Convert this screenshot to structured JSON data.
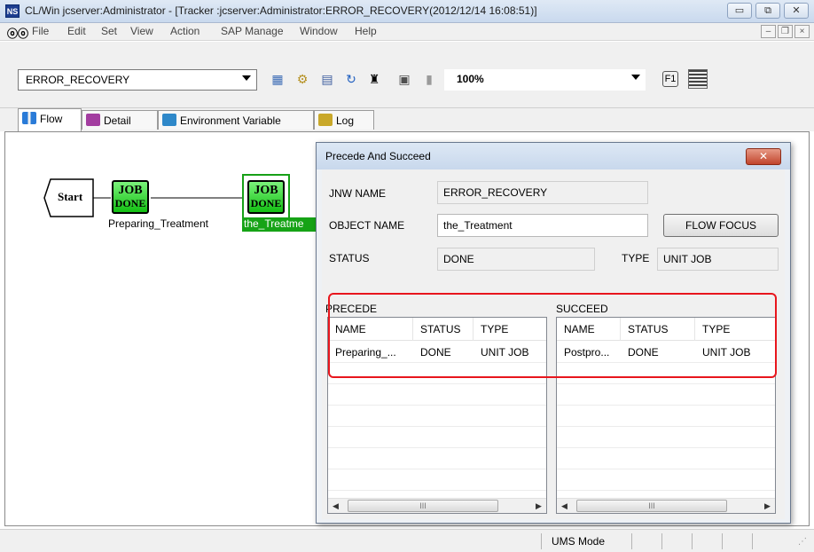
{
  "window": {
    "title": "CL/Win jcserver:Administrator - [Tracker :jcserver:Administrator:ERROR_RECOVERY(2012/12/14 16:08:51)]",
    "app_icon": "NS",
    "minimize": "▭",
    "restore": "⧉",
    "close": "✕"
  },
  "menu": {
    "items": [
      "File",
      "Edit",
      "Set",
      "View",
      "Action",
      "SAP Manage",
      "Window",
      "Help"
    ],
    "mdi_minimize": "–",
    "mdi_restore": "❐",
    "mdi_close": "×"
  },
  "toolbar": {
    "jobnet_select": "ERROR_RECOVERY",
    "zoom_select": "100%"
  },
  "tabs": [
    {
      "label": "Flow",
      "active": true
    },
    {
      "label": "Detail",
      "active": false
    },
    {
      "label": "Environment Variable",
      "active": false
    },
    {
      "label": "Log",
      "active": false
    }
  ],
  "flow": {
    "start_label": "Start",
    "job_line1": "JOB",
    "job_line2": "DONE",
    "job1_name": "Preparing_Treatment",
    "job2_name": "the_Treatme"
  },
  "dialog": {
    "title": "Precede And Succeed",
    "close_label": "✕",
    "jnw_name_label": "JNW NAME",
    "jnw_name_value": "ERROR_RECOVERY",
    "object_name_label": "OBJECT NAME",
    "object_name_value": "the_Treatment",
    "flow_focus_button": "FLOW FOCUS",
    "status_label": "STATUS",
    "status_value": "DONE",
    "type_label": "TYPE",
    "type_value": "UNIT JOB",
    "precede": {
      "caption": "PRECEDE",
      "columns": [
        "NAME",
        "STATUS",
        "TYPE"
      ],
      "rows": [
        [
          "Preparing_...",
          "DONE",
          "UNIT JOB"
        ]
      ],
      "scroll_thumb": "III"
    },
    "succeed": {
      "caption": "SUCCEED",
      "columns": [
        "NAME",
        "STATUS",
        "TYPE"
      ],
      "rows": [
        [
          "Postpro...",
          "DONE",
          "UNIT JOB"
        ]
      ],
      "scroll_thumb": "III"
    }
  },
  "statusbar": {
    "mode": "UMS Mode"
  }
}
